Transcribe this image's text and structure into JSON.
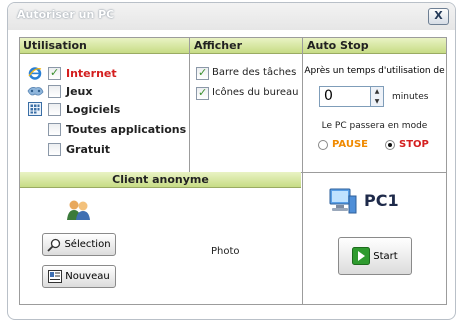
{
  "window": {
    "title": "Autoriser un PC",
    "close_label": "X"
  },
  "sections": {
    "usage": {
      "header": "Utilisation",
      "items": [
        {
          "label": "Internet",
          "checked": true,
          "color": "#d41f1f",
          "icon": "internet-explorer-icon"
        },
        {
          "label": "Jeux",
          "checked": false,
          "color": "#222222",
          "icon": "games-icon"
        },
        {
          "label": "Logiciels",
          "checked": false,
          "color": "#222222",
          "icon": "software-icon"
        },
        {
          "label": "Toutes applications",
          "checked": false,
          "color": "#222222",
          "icon": ""
        },
        {
          "label": "Gratuit",
          "checked": false,
          "color": "#222222",
          "icon": ""
        }
      ]
    },
    "display": {
      "header": "Afficher",
      "items": [
        {
          "label": "Barre des tâches",
          "checked": true
        },
        {
          "label": "Icônes du bureau",
          "checked": true
        }
      ]
    },
    "autostop": {
      "header": "Auto Stop",
      "after_label": "Après un temps d'utilisation de",
      "minutes_value": "0",
      "minutes_label": "minutes",
      "mode_label": "Le PC passera en mode",
      "options": [
        {
          "label": "PAUSE",
          "selected": false,
          "color": "#f08a00"
        },
        {
          "label": "STOP",
          "selected": true,
          "color": "#d41f1f"
        }
      ]
    },
    "client": {
      "header": "Client anonyme",
      "select_label": "Sélection",
      "new_label": "Nouveau",
      "photo_label": "Photo"
    },
    "pc": {
      "name": "PC1",
      "start_label": "Start"
    }
  }
}
